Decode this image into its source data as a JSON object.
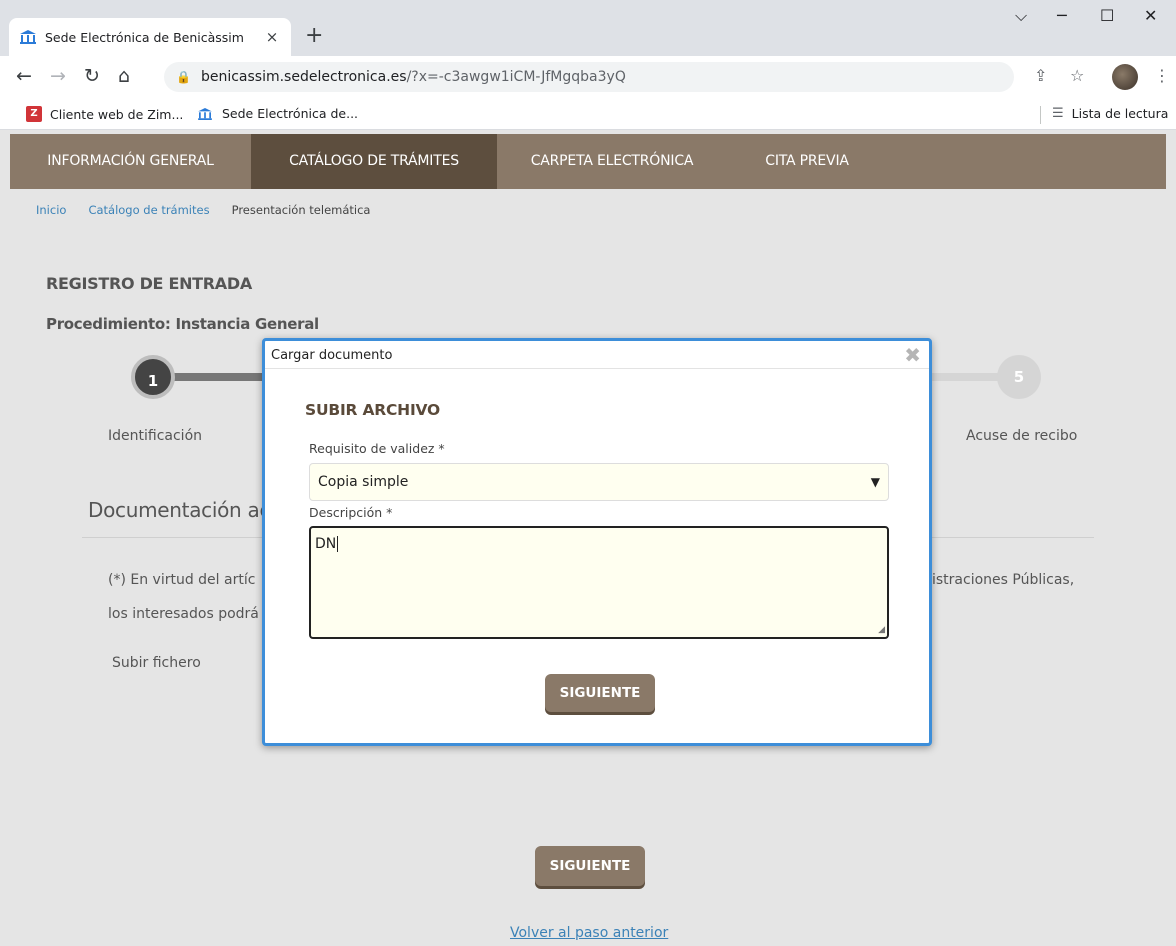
{
  "browser": {
    "tab_title": "Sede Electrónica de Benicàssim",
    "tab_close": "×",
    "new_tab": "+",
    "url_host": "benicassim.sedelectronica.es",
    "url_path": "/?x=-c3awgw1iCM-JfMgqba3yQ",
    "bookmarks": [
      {
        "label": "Cliente web de Zim..."
      },
      {
        "label": "Sede Electrónica de..."
      }
    ],
    "zimbra_badge": "Z",
    "reading_list": "Lista de lectura",
    "colors": {
      "tabstrip": "#dee1e6",
      "omnibox": "#f1f3f4"
    }
  },
  "nav": {
    "items": [
      {
        "label": "INFORMACIÓN GENERAL"
      },
      {
        "label": "CATÁLOGO DE TRÁMITES"
      },
      {
        "label": "CARPETA ELECTRÓNICA"
      },
      {
        "label": "CITA PREVIA"
      }
    ],
    "colors": {
      "bar": "#8a7968",
      "active": "#5d4e3e"
    }
  },
  "breadcrumb": {
    "items": [
      "Inicio",
      "Catálogo de trámites",
      "Presentación telemática"
    ]
  },
  "page": {
    "title": "REGISTRO DE ENTRADA",
    "procedure": "Procedimiento: Instancia General",
    "steps": [
      {
        "number": "1",
        "label": "Identificación"
      },
      {
        "number": "5",
        "label": "Acuse de recibo"
      }
    ],
    "doc_heading": "Documentación ac",
    "legal_line1_left": "(*) En virtud del artíc",
    "legal_line1_right": "istraciones Públicas,",
    "legal_line2_left": "los interesados podrá",
    "upload_label": "Subir fichero",
    "next_button": "SIGUIENTE",
    "back_link": "Volver al paso anterior"
  },
  "modal": {
    "title": "Cargar documento",
    "close": "✖",
    "heading": "SUBIR ARCHIVO",
    "validity_label": "Requisito de validez *",
    "validity_value": "Copia simple",
    "description_label": "Descripción *",
    "description_value": "DN",
    "next_button": "SIGUIENTE",
    "colors": {
      "border": "#3d8ed9",
      "field_bg": "#fffff0",
      "button": "#8a7968"
    }
  }
}
